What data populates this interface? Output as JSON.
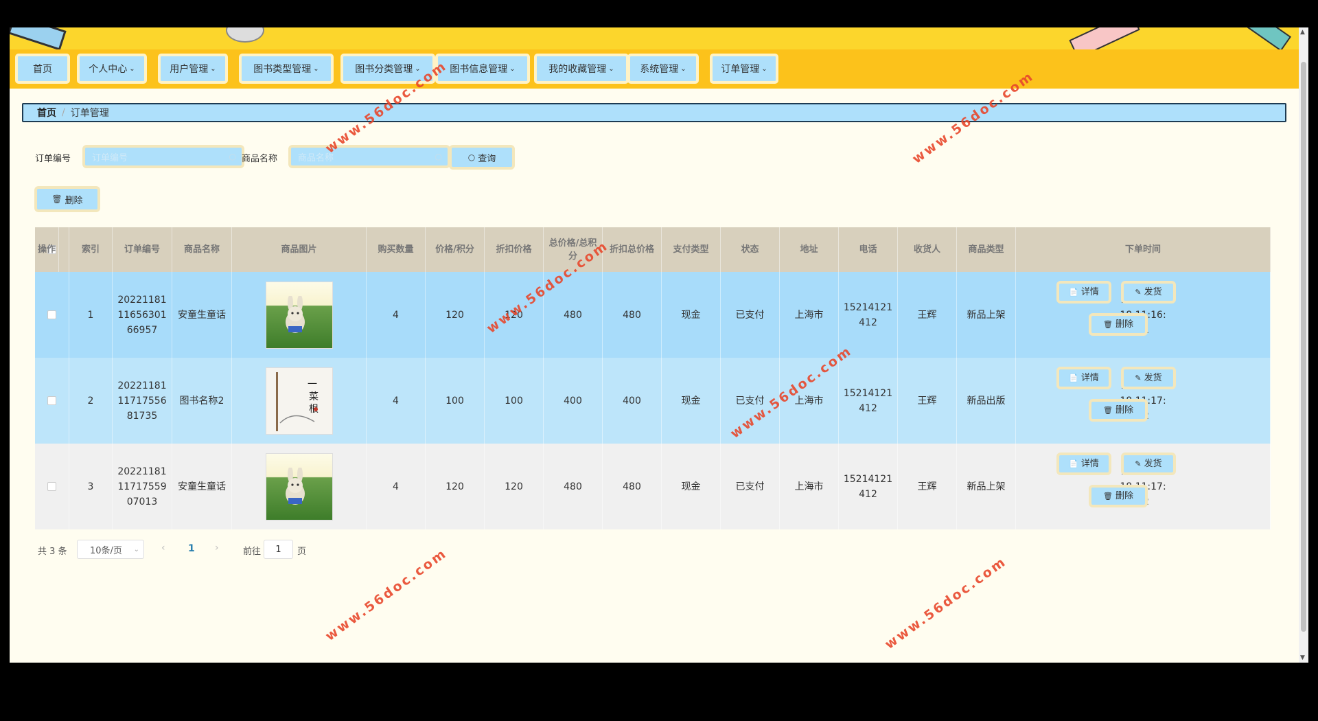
{
  "nav": {
    "items": [
      {
        "label": "首页",
        "has_menu": false
      },
      {
        "label": "个人中心",
        "has_menu": true
      },
      {
        "label": "用户管理",
        "has_menu": true
      },
      {
        "label": "图书类型管理",
        "has_menu": true
      },
      {
        "label": "图书分类管理",
        "has_menu": true
      },
      {
        "label": "图书信息管理",
        "has_menu": true
      },
      {
        "label": "我的收藏管理",
        "has_menu": true
      },
      {
        "label": "系统管理",
        "has_menu": true
      },
      {
        "label": "订单管理",
        "has_menu": true
      }
    ]
  },
  "breadcrumb": {
    "home": "首页",
    "separator": "/",
    "current": "订单管理"
  },
  "search": {
    "order_no_label": "订单编号",
    "order_no_placeholder": "订单编号",
    "goods_name_label": "商品名称",
    "goods_name_placeholder": "商品名称",
    "query_button": "查询"
  },
  "toolbar": {
    "delete_button": "删除"
  },
  "table": {
    "columns": [
      "索引",
      "订单编号",
      "商品名称",
      "商品图片",
      "购买数量",
      "价格/积分",
      "折扣价格",
      "总价格/总积分",
      "折扣总价格",
      "支付类型",
      "状态",
      "地址",
      "电话",
      "收货人",
      "商品类型",
      "下单时间",
      "操作"
    ],
    "rows": [
      {
        "index": "1",
        "order_no": "2022118111656301 66957",
        "goods_name": "安童生童话",
        "image": "rabbit-book-cover",
        "qty": "4",
        "price": "120",
        "discount_price": "120",
        "total": "480",
        "discount_total": "480",
        "pay_type": "现金",
        "status": "已支付",
        "address": "上海市",
        "phone": "15214121412",
        "receiver": "王辉",
        "goods_type": "新品上架",
        "order_time": "2022-01-18 11:16:51"
      },
      {
        "index": "2",
        "order_no": "2022118111717556 81735",
        "goods_name": "图书名称2",
        "image": "ink-book-cover",
        "qty": "4",
        "price": "100",
        "discount_price": "100",
        "total": "400",
        "discount_total": "400",
        "pay_type": "现金",
        "status": "已支付",
        "address": "上海市",
        "phone": "15214121412",
        "receiver": "王辉",
        "goods_type": "新品出版",
        "order_time": "2022-01-18 11:17:12"
      },
      {
        "index": "3",
        "order_no": "2022118111717559 07013",
        "goods_name": "安童生童话",
        "image": "rabbit-book-cover",
        "qty": "4",
        "price": "120",
        "discount_price": "120",
        "total": "480",
        "discount_total": "480",
        "pay_type": "现金",
        "status": "已支付",
        "address": "上海市",
        "phone": "15214121412",
        "receiver": "王辉",
        "goods_type": "新品上架",
        "order_time": "2022-01-18 11:17:12"
      }
    ],
    "ops": {
      "detail": "详情",
      "ship": "发货",
      "delete": "删除"
    }
  },
  "pagination": {
    "total": "共 3 条",
    "page_size": "10条/页",
    "current_page": "1",
    "goto_label": "前往",
    "goto_value": "1",
    "page_unit": "页"
  },
  "watermark": "www.56doc.com",
  "colors": {
    "nav_bg": "#fcc21b",
    "button_bg": "#aee0fb",
    "header_row": "#d8d0bd",
    "watermark": "#e8482c"
  }
}
